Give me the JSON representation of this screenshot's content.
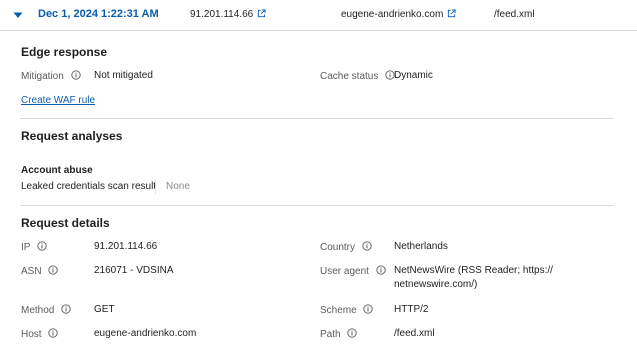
{
  "header": {
    "timestamp": "Dec 1, 2024 1:22:31 AM",
    "ip": "91.201.114.66",
    "host": "eugene-andrienko.com",
    "path": "/feed.xml"
  },
  "edge_response": {
    "title": "Edge response",
    "mitigation_label": "Mitigation",
    "mitigation_value": "Not mitigated",
    "cache_status_label": "Cache status",
    "cache_status_value": "Dynamic",
    "waf_link": "Create WAF rule"
  },
  "request_analyses": {
    "title": "Request analyses",
    "subtitle": "Account abuse",
    "leaked_label": "Leaked credentials scan result",
    "leaked_value": "None"
  },
  "request_details": {
    "title": "Request details",
    "ip_label": "IP",
    "ip_value": "91.201.114.66",
    "country_label": "Country",
    "country_value": "Netherlands",
    "asn_label": "ASN",
    "asn_value": "216071 - VDSINA",
    "user_agent_label": "User agent",
    "user_agent_line1": "NetNewsWire (RSS Reader; https://",
    "user_agent_line2": "netnewswire.com/)",
    "method_label": "Method",
    "method_value": "GET",
    "scheme_label": "Scheme",
    "scheme_value": "HTTP/2",
    "host_label": "Host",
    "host_value": "eugene-andrienko.com",
    "path_label": "Path",
    "path_value": "/feed.xml"
  },
  "colors": {
    "link": "#0b5cad",
    "label": "#5c5c5c",
    "divider": "#d9d9d9"
  },
  "icons": {
    "expand": "chevron-down-icon",
    "external": "external-link-icon",
    "info": "info-icon"
  }
}
